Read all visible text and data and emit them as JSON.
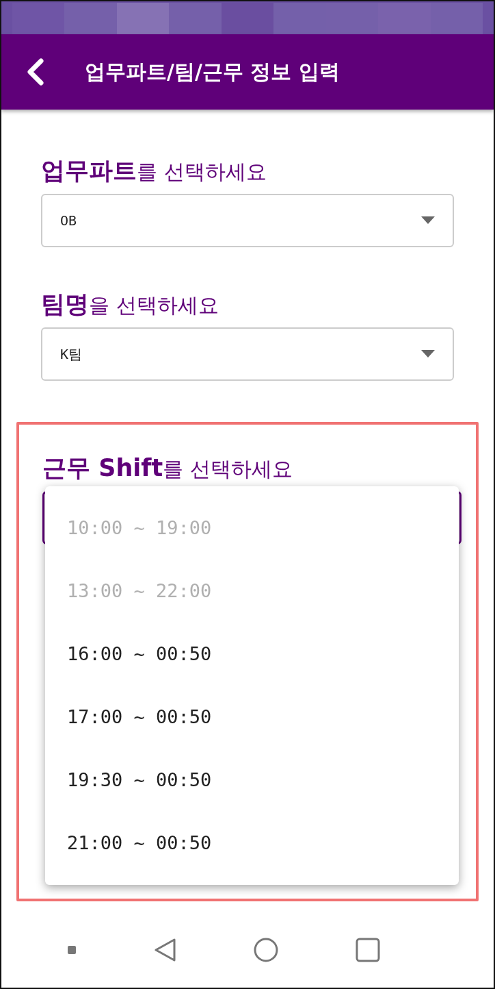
{
  "header": {
    "title": "업무파트/팀/근무 정보 입력"
  },
  "fields": [
    {
      "label": "**업무파트**를 선택하세요",
      "value": "OB"
    },
    {
      "label": "**팀명**을 선택하세요",
      "value": "K팀"
    },
    {
      "label": "**근무 Shift**를 선택하세요",
      "highlighted": true,
      "expanded": true
    }
  ],
  "dropdown": {
    "options": [
      {
        "label": "10:00 ~ 19:00",
        "disabled": true
      },
      {
        "label": "13:00 ~ 22:00",
        "disabled": true
      },
      {
        "label": "16:00 ~ 00:50",
        "disabled": false
      },
      {
        "label": "17:00 ~ 00:50",
        "disabled": false
      },
      {
        "label": "19:30 ~ 00:50",
        "disabled": false
      },
      {
        "label": "21:00 ~ 00:50",
        "disabled": false
      }
    ]
  }
}
